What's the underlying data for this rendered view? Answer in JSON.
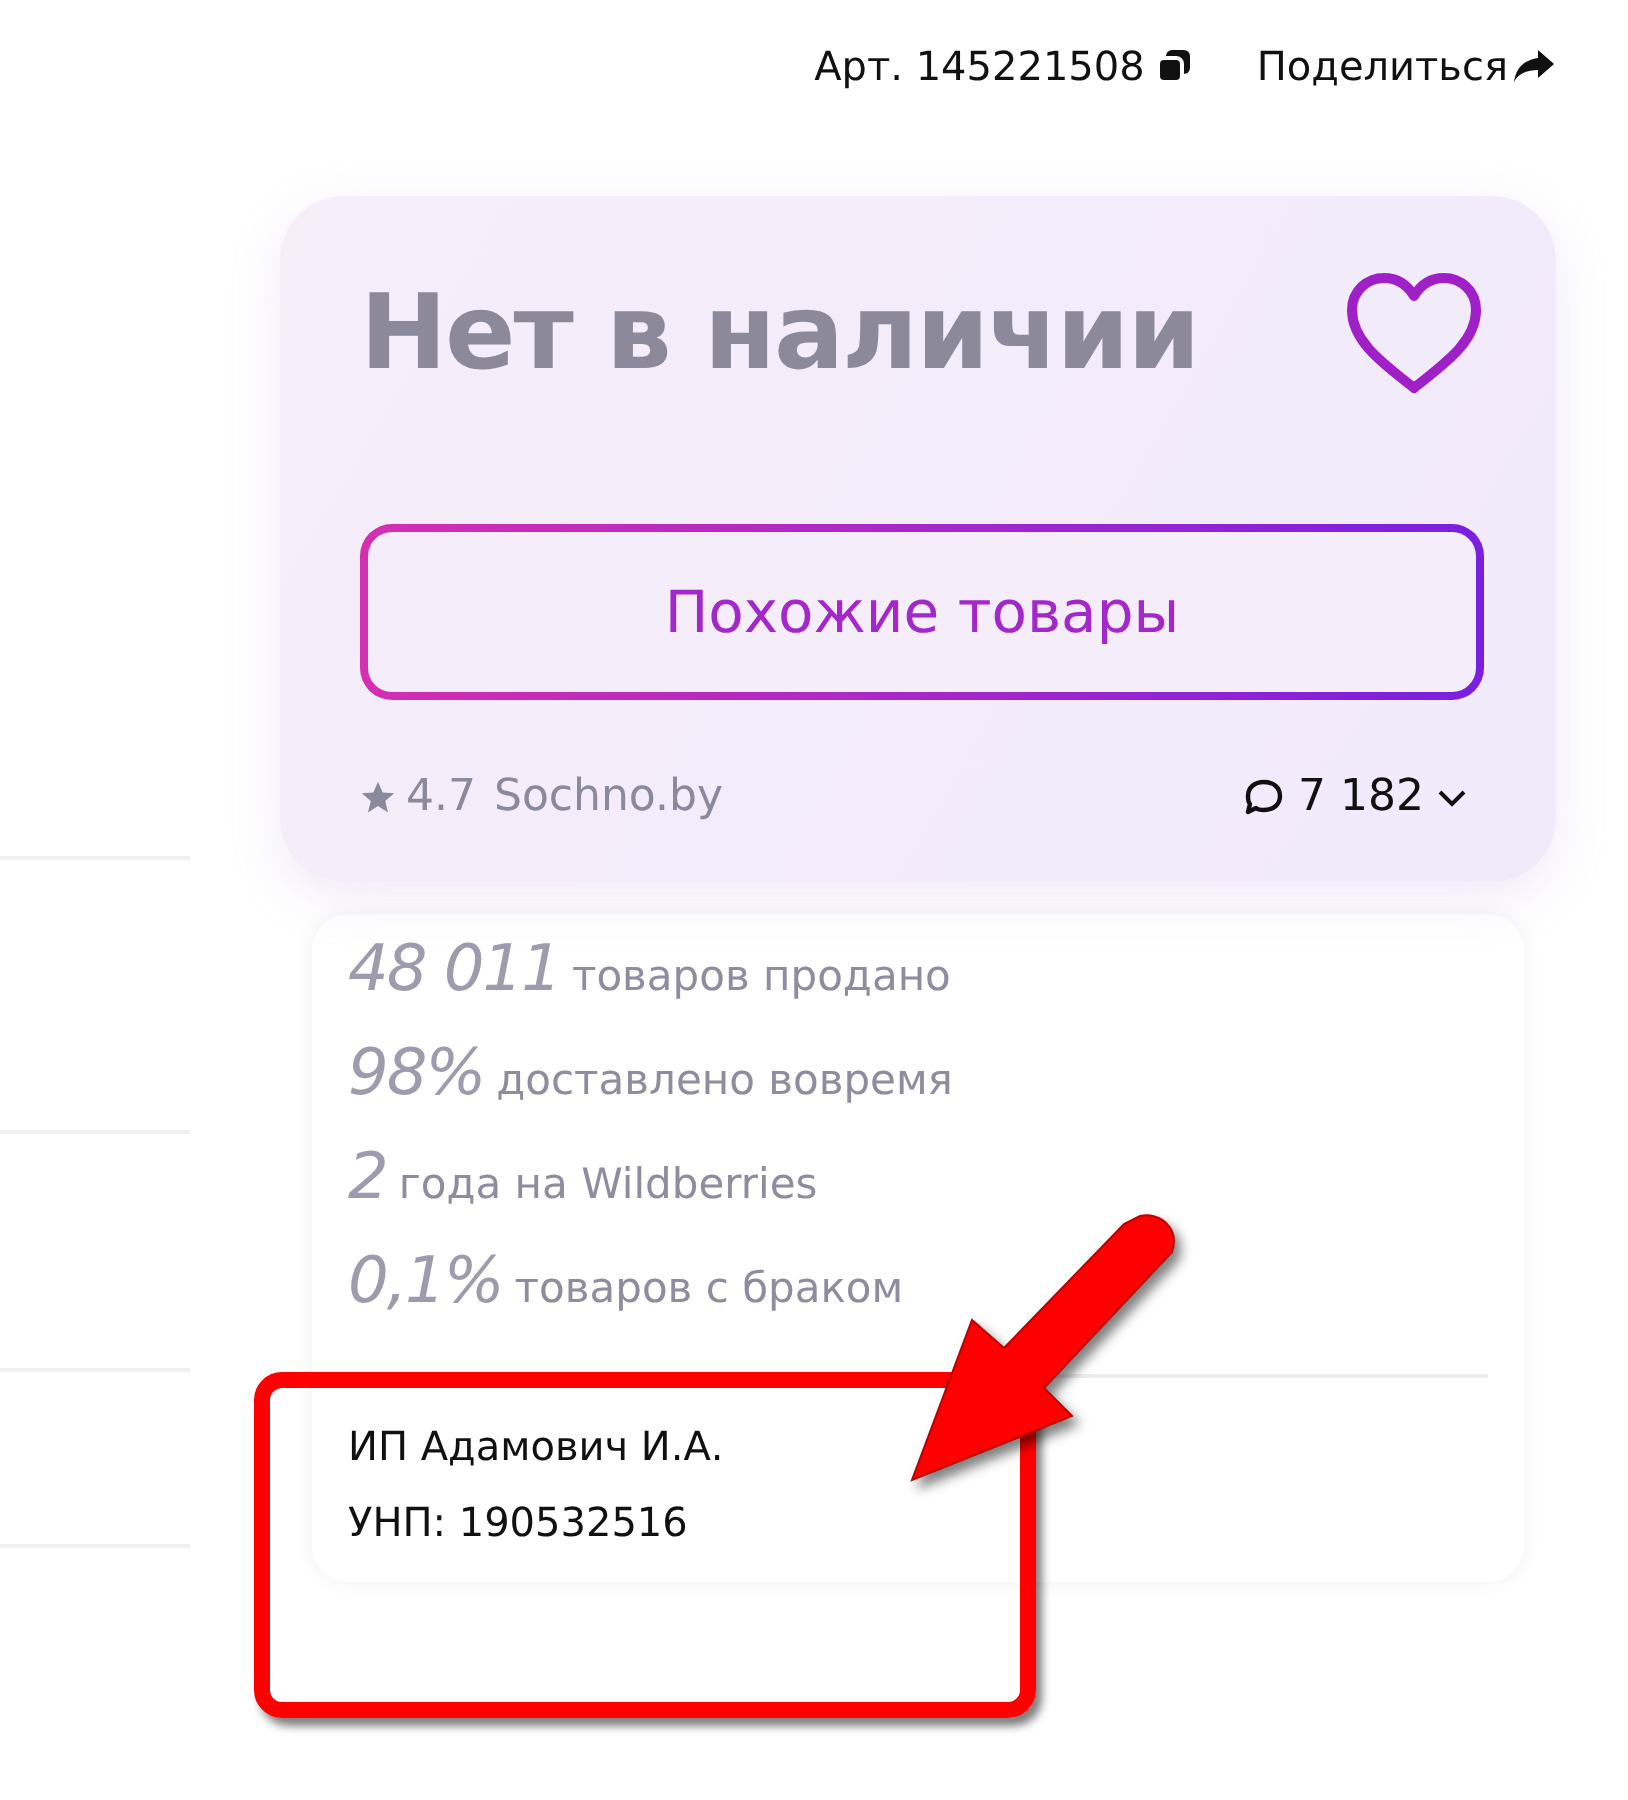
{
  "header": {
    "article": "Арт. 145221508",
    "share": "Поделиться"
  },
  "offer": {
    "status": "Нет в наличии",
    "favorite": false,
    "similar_button": "Похожие товары",
    "rating": "4.7",
    "seller_link": "Sochno.by",
    "reviews": "7 182"
  },
  "stats": [
    {
      "value": "48 011",
      "label": "товаров продано"
    },
    {
      "value": "98%",
      "label": "доставлено вовремя"
    },
    {
      "value": "2",
      "label": "года на Wildberries"
    },
    {
      "value": "0,1%",
      "label": "товаров с браком"
    }
  ],
  "seller": {
    "name": "ИП Адамович И.А.",
    "unp": "УНП: 190532516"
  }
}
